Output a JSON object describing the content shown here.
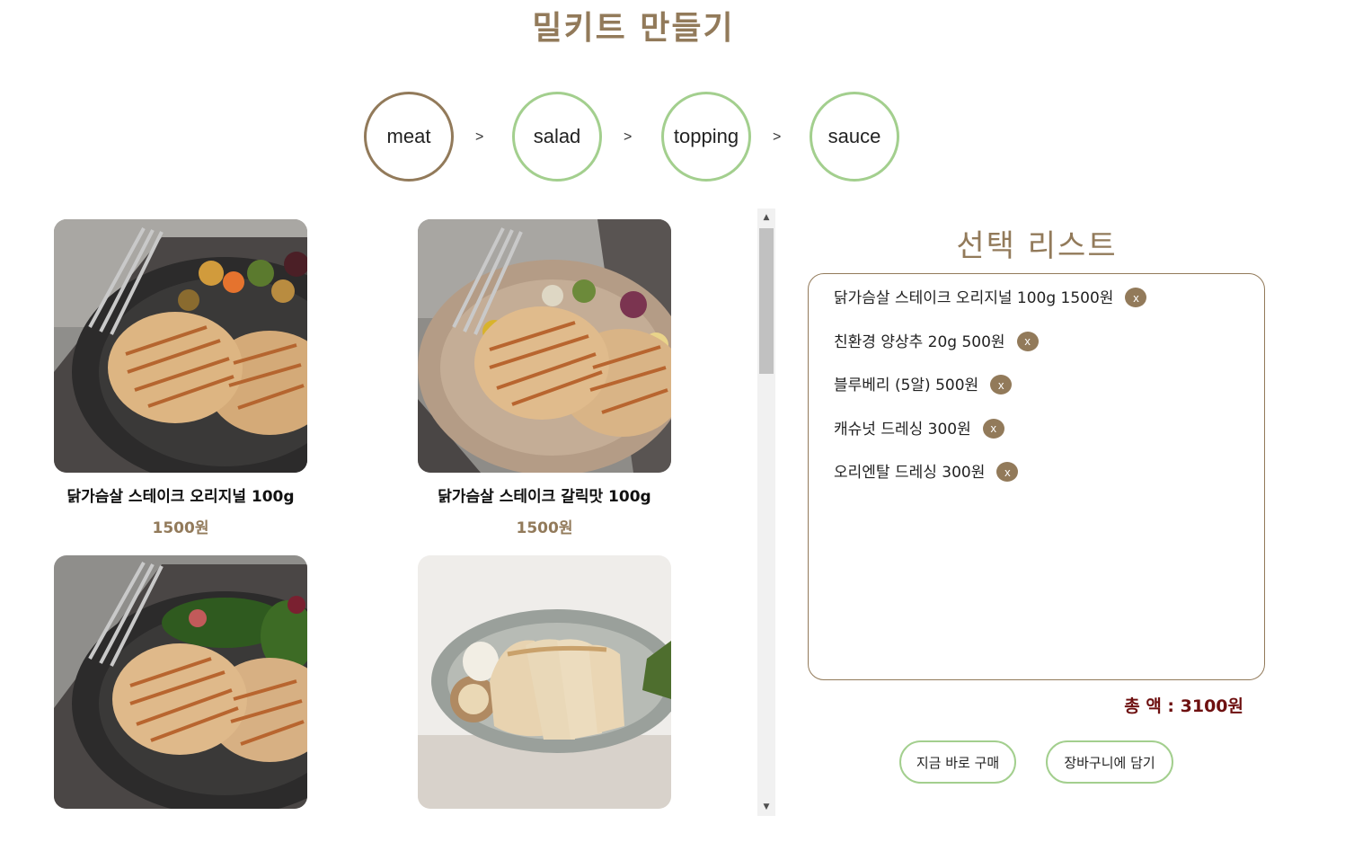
{
  "title": "밀키트 만들기",
  "steps": [
    {
      "label": "meat",
      "active": true
    },
    {
      "label": "salad",
      "active": false
    },
    {
      "label": "topping",
      "active": false
    },
    {
      "label": "sauce",
      "active": false
    }
  ],
  "step_separator": ">",
  "products": [
    {
      "name": "닭가슴살 스테이크 오리지널 100g",
      "price": "1500원",
      "image": "chicken-steak-original-photo"
    },
    {
      "name": "닭가슴살 스테이크 갈릭맛 100g",
      "price": "1500원",
      "image": "chicken-steak-garlic-photo"
    },
    {
      "name": "",
      "price": "",
      "image": "chicken-steak-greens-photo"
    },
    {
      "name": "",
      "price": "",
      "image": "sliced-chicken-breast-photo"
    }
  ],
  "selection": {
    "title": "선택 리스트",
    "items": [
      {
        "text": "닭가슴살 스테이크 오리지널 100g 1500원",
        "remove_label": "x"
      },
      {
        "text": "친환경 양상추 20g 500원",
        "remove_label": "x"
      },
      {
        "text": "블루베리 (5알) 500원",
        "remove_label": "x"
      },
      {
        "text": "캐슈넛 드레싱 300원",
        "remove_label": "x"
      },
      {
        "text": "오리엔탈 드레싱 300원",
        "remove_label": "x"
      }
    ],
    "total_label": "총 액 : 3100원"
  },
  "actions": {
    "buy_now": "지금 바로 구매",
    "add_to_cart": "장바구니에 담기"
  },
  "colors": {
    "accent_brown": "#927a5a",
    "accent_green": "#a3cf8e",
    "total_red": "#6e1010"
  }
}
